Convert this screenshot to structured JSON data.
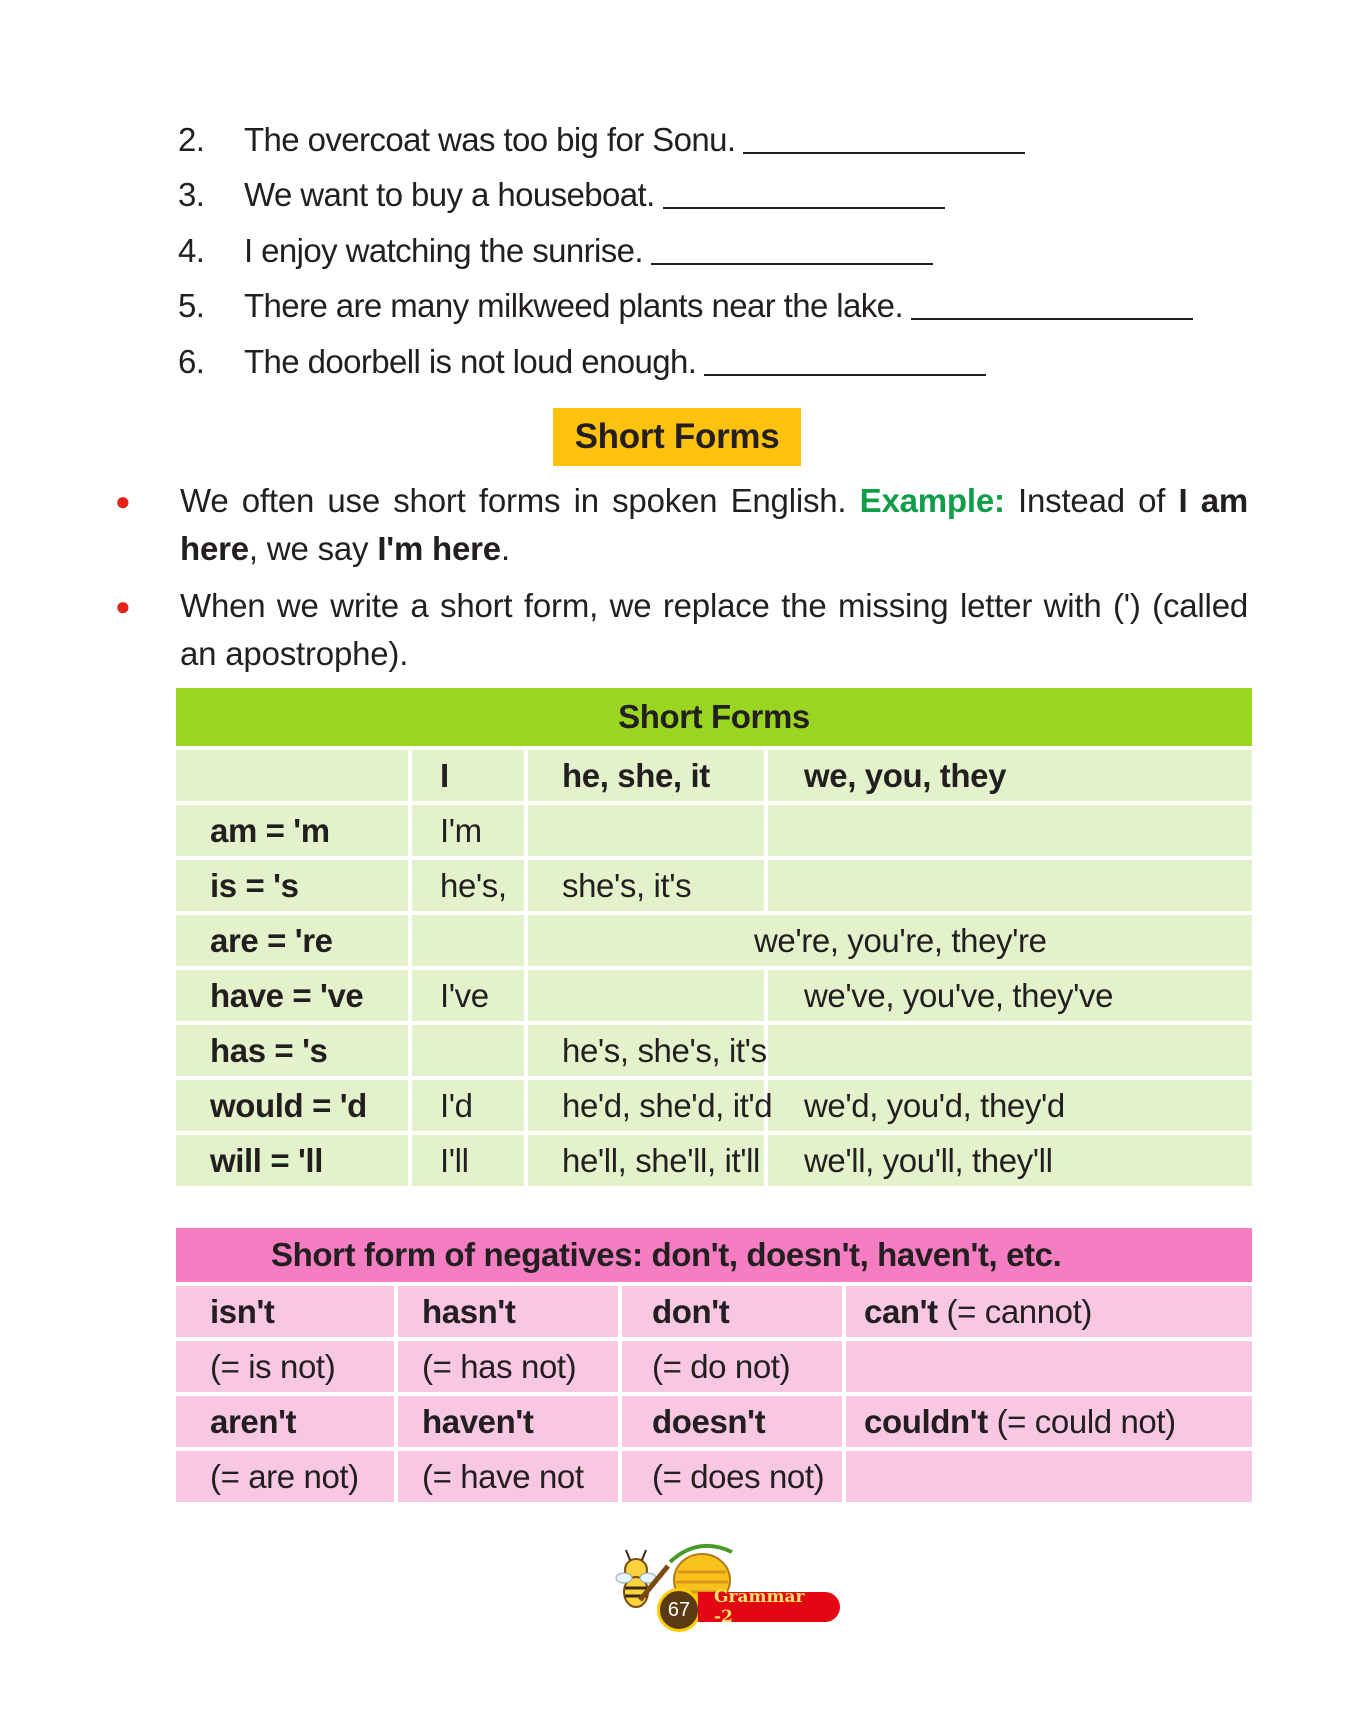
{
  "exercise": {
    "items": [
      {
        "num": "2.",
        "text": "The overcoat was too big for Sonu."
      },
      {
        "num": "3.",
        "text": "We want to buy a houseboat."
      },
      {
        "num": "4.",
        "text": "I enjoy watching the sunrise."
      },
      {
        "num": "5.",
        "text": "There are many milkweed plants near the lake."
      },
      {
        "num": "6.",
        "text": "The doorbell is not loud enough."
      }
    ]
  },
  "section_title": "Short Forms",
  "bullets": {
    "b1": {
      "text1": "We often use short forms in spoken English.",
      "example_label": "Example:",
      "text2": "Instead of",
      "bold1": "I am here",
      "text3": ", we say",
      "bold2": "I'm here",
      "text4": "."
    },
    "b2": {
      "text": "When we write a short form, we replace the missing letter with (') (called an apostrophe)."
    }
  },
  "short_forms_table": {
    "title": "Short Forms",
    "headers": [
      "",
      "I",
      "he, she, it",
      "we, you, they"
    ],
    "rows": [
      [
        "am = 'm",
        "I'm",
        "",
        ""
      ],
      [
        "is = 's",
        "he's,",
        "she's, it's",
        ""
      ],
      [
        "are = 're",
        "",
        "we're, you're, they're",
        ""
      ],
      [
        "have = 've",
        "I've",
        "",
        "we've, you've, they've"
      ],
      [
        "has = 's",
        "",
        "he's, she's, it's",
        ""
      ],
      [
        "would = 'd",
        "I'd",
        "he'd, she'd, it'd",
        "we'd, you'd, they'd"
      ],
      [
        "will = 'll",
        "I'll",
        "he'll, she'll, it'll",
        "we'll, you'll, they'll"
      ]
    ]
  },
  "negatives_table": {
    "title": "Short form of negatives: don't, doesn't, haven't, etc.",
    "rows": [
      [
        "isn't",
        "hasn't",
        "don't",
        "can't",
        "(= cannot)"
      ],
      [
        "(= is not)",
        "(= has not)",
        "(= do not)",
        "",
        ""
      ],
      [
        "aren't",
        "haven't",
        "doesn't",
        "couldn't",
        "(= could not)"
      ],
      [
        "(= are not)",
        "(= have not",
        "(= does not)",
        "",
        ""
      ]
    ]
  },
  "footer": {
    "page_number": "67",
    "book_label": "Grammar -2"
  }
}
